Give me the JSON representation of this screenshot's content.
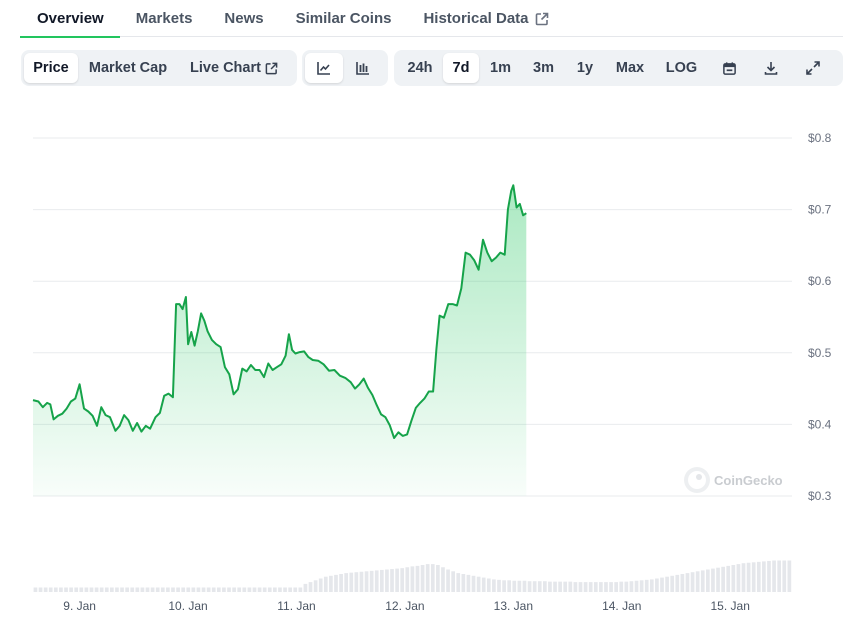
{
  "tabs": [
    {
      "label": "Overview",
      "active": true
    },
    {
      "label": "Markets",
      "active": false
    },
    {
      "label": "News",
      "active": false
    },
    {
      "label": "Similar Coins",
      "active": false
    },
    {
      "label": "Historical Data",
      "active": false,
      "external": true
    }
  ],
  "toolbar": {
    "metric_tabs": [
      {
        "label": "Price",
        "active": true
      },
      {
        "label": "Market Cap",
        "active": false
      },
      {
        "label": "Live Chart",
        "active": false,
        "external": true
      }
    ],
    "chart_style": [
      {
        "icon": "line-chart-icon",
        "active": true
      },
      {
        "icon": "candlestick-chart-icon",
        "active": false
      }
    ],
    "ranges": [
      {
        "label": "24h",
        "active": false
      },
      {
        "label": "7d",
        "active": true
      },
      {
        "label": "1m",
        "active": false
      },
      {
        "label": "3m",
        "active": false
      },
      {
        "label": "1y",
        "active": false
      },
      {
        "label": "Max",
        "active": false
      },
      {
        "label": "LOG",
        "active": false
      }
    ],
    "actions": [
      "calendar-icon",
      "download-icon",
      "fullscreen-icon"
    ]
  },
  "watermark": "CoinGecko",
  "colors": {
    "line": "#16a34a",
    "area": "#22c55e",
    "volume": "#e5e7eb",
    "accent": "#22c55e"
  },
  "chart_data": {
    "type": "area",
    "y_ticks": [
      "$0.8",
      "$0.7",
      "$0.6",
      "$0.5",
      "$0.4",
      "$0.3"
    ],
    "ylim": [
      0.3,
      0.8
    ],
    "x_ticks": [
      "9. Jan",
      "10. Jan",
      "11. Jan",
      "12. Jan",
      "13. Jan",
      "14. Jan",
      "15. Jan"
    ],
    "x_range": [
      8.57,
      15.57
    ],
    "series": [
      {
        "values": [
          [
            8.57,
            0.434
          ],
          [
            8.62,
            0.432
          ],
          [
            8.66,
            0.424
          ],
          [
            8.7,
            0.43
          ],
          [
            8.73,
            0.428
          ],
          [
            8.76,
            0.407
          ],
          [
            8.8,
            0.412
          ],
          [
            8.84,
            0.415
          ],
          [
            8.88,
            0.422
          ],
          [
            8.92,
            0.432
          ],
          [
            8.96,
            0.436
          ],
          [
            9.0,
            0.456
          ],
          [
            9.04,
            0.422
          ],
          [
            9.08,
            0.418
          ],
          [
            9.12,
            0.412
          ],
          [
            9.16,
            0.398
          ],
          [
            9.2,
            0.424
          ],
          [
            9.24,
            0.413
          ],
          [
            9.28,
            0.41
          ],
          [
            9.33,
            0.391
          ],
          [
            9.37,
            0.398
          ],
          [
            9.41,
            0.413
          ],
          [
            9.45,
            0.406
          ],
          [
            9.49,
            0.391
          ],
          [
            9.53,
            0.402
          ],
          [
            9.57,
            0.39
          ],
          [
            9.61,
            0.398
          ],
          [
            9.65,
            0.394
          ],
          [
            9.7,
            0.41
          ],
          [
            9.74,
            0.416
          ],
          [
            9.78,
            0.44
          ],
          [
            9.82,
            0.443
          ],
          [
            9.86,
            0.438
          ],
          [
            9.89,
            0.568
          ],
          [
            9.92,
            0.568
          ],
          [
            9.95,
            0.561
          ],
          [
            9.98,
            0.578
          ],
          [
            10.0,
            0.512
          ],
          [
            10.03,
            0.529
          ],
          [
            10.06,
            0.51
          ],
          [
            10.09,
            0.53
          ],
          [
            10.12,
            0.555
          ],
          [
            10.15,
            0.545
          ],
          [
            10.18,
            0.53
          ],
          [
            10.22,
            0.518
          ],
          [
            10.26,
            0.512
          ],
          [
            10.3,
            0.508
          ],
          [
            10.34,
            0.48
          ],
          [
            10.38,
            0.47
          ],
          [
            10.42,
            0.442
          ],
          [
            10.46,
            0.449
          ],
          [
            10.5,
            0.478
          ],
          [
            10.54,
            0.474
          ],
          [
            10.58,
            0.483
          ],
          [
            10.62,
            0.476
          ],
          [
            10.66,
            0.476
          ],
          [
            10.7,
            0.466
          ],
          [
            10.74,
            0.485
          ],
          [
            10.78,
            0.476
          ],
          [
            10.82,
            0.48
          ],
          [
            10.86,
            0.484
          ],
          [
            10.9,
            0.496
          ],
          [
            10.93,
            0.526
          ],
          [
            10.96,
            0.504
          ],
          [
            10.99,
            0.499
          ],
          [
            11.03,
            0.501
          ],
          [
            11.07,
            0.502
          ],
          [
            11.11,
            0.494
          ],
          [
            11.15,
            0.49
          ],
          [
            11.2,
            0.489
          ],
          [
            11.25,
            0.484
          ],
          [
            11.3,
            0.475
          ],
          [
            11.35,
            0.476
          ],
          [
            11.4,
            0.468
          ],
          [
            11.45,
            0.465
          ],
          [
            11.5,
            0.459
          ],
          [
            11.54,
            0.45
          ],
          [
            11.58,
            0.456
          ],
          [
            11.62,
            0.464
          ],
          [
            11.66,
            0.451
          ],
          [
            11.7,
            0.441
          ],
          [
            11.74,
            0.427
          ],
          [
            11.78,
            0.414
          ],
          [
            11.82,
            0.41
          ],
          [
            11.86,
            0.399
          ],
          [
            11.9,
            0.381
          ],
          [
            11.94,
            0.389
          ],
          [
            11.98,
            0.384
          ],
          [
            12.02,
            0.386
          ],
          [
            12.06,
            0.405
          ],
          [
            12.1,
            0.423
          ],
          [
            12.14,
            0.43
          ],
          [
            12.18,
            0.436
          ],
          [
            12.22,
            0.446
          ],
          [
            12.26,
            0.446
          ],
          [
            12.29,
            0.505
          ],
          [
            12.32,
            0.552
          ],
          [
            12.36,
            0.549
          ],
          [
            12.4,
            0.568
          ],
          [
            12.44,
            0.568
          ],
          [
            12.48,
            0.566
          ],
          [
            12.52,
            0.59
          ],
          [
            12.56,
            0.64
          ],
          [
            12.6,
            0.637
          ],
          [
            12.64,
            0.629
          ],
          [
            12.68,
            0.616
          ],
          [
            12.72,
            0.658
          ],
          [
            12.76,
            0.64
          ],
          [
            12.8,
            0.628
          ],
          [
            12.84,
            0.633
          ],
          [
            12.88,
            0.64
          ],
          [
            12.92,
            0.637
          ],
          [
            12.95,
            0.7
          ],
          [
            12.98,
            0.726
          ],
          [
            13.0,
            0.734
          ],
          [
            13.03,
            0.703
          ],
          [
            13.06,
            0.708
          ],
          [
            13.09,
            0.692
          ],
          [
            13.12,
            0.695
          ]
        ]
      }
    ],
    "volume": [
      0.1,
      0.1,
      0.1,
      0.1,
      0.1,
      0.1,
      0.1,
      0.1,
      0.1,
      0.1,
      0.1,
      0.1,
      0.1,
      0.1,
      0.1,
      0.1,
      0.1,
      0.1,
      0.1,
      0.1,
      0.1,
      0.1,
      0.1,
      0.1,
      0.1,
      0.1,
      0.1,
      0.1,
      0.1,
      0.1,
      0.1,
      0.1,
      0.1,
      0.1,
      0.1,
      0.1,
      0.1,
      0.1,
      0.1,
      0.1,
      0.1,
      0.1,
      0.1,
      0.1,
      0.1,
      0.1,
      0.1,
      0.1,
      0.1,
      0.1,
      0.1,
      0.1,
      0.1,
      0.18,
      0.22,
      0.26,
      0.3,
      0.34,
      0.36,
      0.38,
      0.4,
      0.42,
      0.43,
      0.44,
      0.45,
      0.46,
      0.47,
      0.48,
      0.49,
      0.5,
      0.51,
      0.52,
      0.53,
      0.55,
      0.57,
      0.58,
      0.6,
      0.62,
      0.62,
      0.6,
      0.55,
      0.5,
      0.46,
      0.42,
      0.4,
      0.38,
      0.36,
      0.34,
      0.32,
      0.3,
      0.28,
      0.27,
      0.26,
      0.26,
      0.25,
      0.25,
      0.25,
      0.24,
      0.24,
      0.24,
      0.24,
      0.23,
      0.23,
      0.23,
      0.23,
      0.23,
      0.22,
      0.22,
      0.22,
      0.22,
      0.22,
      0.22,
      0.22,
      0.22,
      0.22,
      0.23,
      0.23,
      0.24,
      0.25,
      0.26,
      0.27,
      0.28,
      0.3,
      0.32,
      0.34,
      0.36,
      0.38,
      0.4,
      0.42,
      0.44,
      0.46,
      0.48,
      0.5,
      0.52,
      0.54,
      0.56,
      0.58,
      0.6,
      0.62,
      0.64,
      0.65,
      0.66,
      0.67,
      0.68,
      0.69,
      0.7,
      0.7,
      0.7,
      0.7
    ]
  }
}
